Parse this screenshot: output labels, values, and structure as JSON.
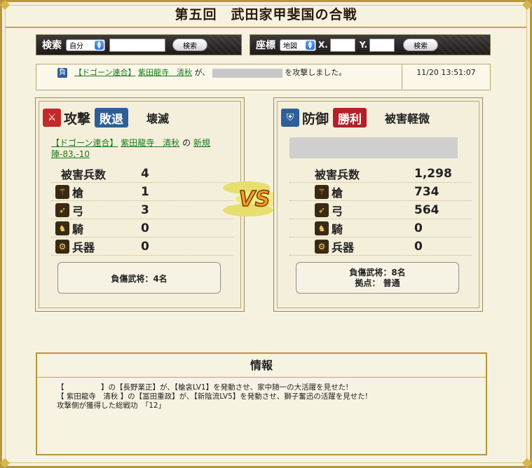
{
  "header": {
    "title": "第五回　武田家甲斐国の合戦"
  },
  "search_bar": {
    "label": "検索",
    "select_value": "自分",
    "input_value": "",
    "button_label": "検索"
  },
  "coord_bar": {
    "label": "座標",
    "select_value": "地図",
    "x_label": "X.",
    "x_value": "",
    "y_label": "Y.",
    "y_value": "",
    "button_label": "検索"
  },
  "log": {
    "badge": "負",
    "alliance": "【ドゴーン連合】",
    "player": "紫田龍寺　清秋",
    "ga": "が、",
    "suffix": "を攻撃しました。",
    "time": "11/20 13:51:07"
  },
  "attack": {
    "role": "攻撃",
    "result": "敗退",
    "damage": "壊滅",
    "alliance": "【ドゴーン連合】",
    "player": "紫田龍寺　清秋",
    "no": "の",
    "place": "新規陣-83,-10",
    "stats": [
      {
        "label": "被害兵数",
        "value": "4",
        "icon": ""
      },
      {
        "label": "槍",
        "value": "1",
        "icon": "spear-icon"
      },
      {
        "label": "弓",
        "value": "3",
        "icon": "bow-icon"
      },
      {
        "label": "騎",
        "value": "0",
        "icon": "horse-icon"
      },
      {
        "label": "兵器",
        "value": "0",
        "icon": "siege-icon"
      }
    ],
    "box_line1": "負傷武将：4名",
    "box_line2": ""
  },
  "defense": {
    "role": "防御",
    "result": "勝利",
    "damage": "被害軽微",
    "stats": [
      {
        "label": "被害兵数",
        "value": "1,298",
        "icon": ""
      },
      {
        "label": "槍",
        "value": "734",
        "icon": "spear-icon"
      },
      {
        "label": "弓",
        "value": "564",
        "icon": "bow-icon"
      },
      {
        "label": "騎",
        "value": "0",
        "icon": "horse-icon"
      },
      {
        "label": "兵器",
        "value": "0",
        "icon": "siege-icon"
      }
    ],
    "box_line1": "負傷武将：8名",
    "box_line2": "拠点：  普通"
  },
  "vs_label": "VS",
  "info": {
    "title": "情報",
    "lines": [
      "【　　　　　】の【長野業正】が、【槍衾LV1】を発動させ、家中随一の大活躍を見せた!",
      "【 紫田龍寺　清秋 】の【冨田重政】が、【新陰流LV5】を発動させ、獅子奮迅の活躍を見せた!",
      "攻撃側が獲得した総戦功　「12」"
    ]
  },
  "colors": {
    "attack_result": "#2d5f96",
    "defense_result": "#b2202a",
    "gold": "#b8963a"
  }
}
